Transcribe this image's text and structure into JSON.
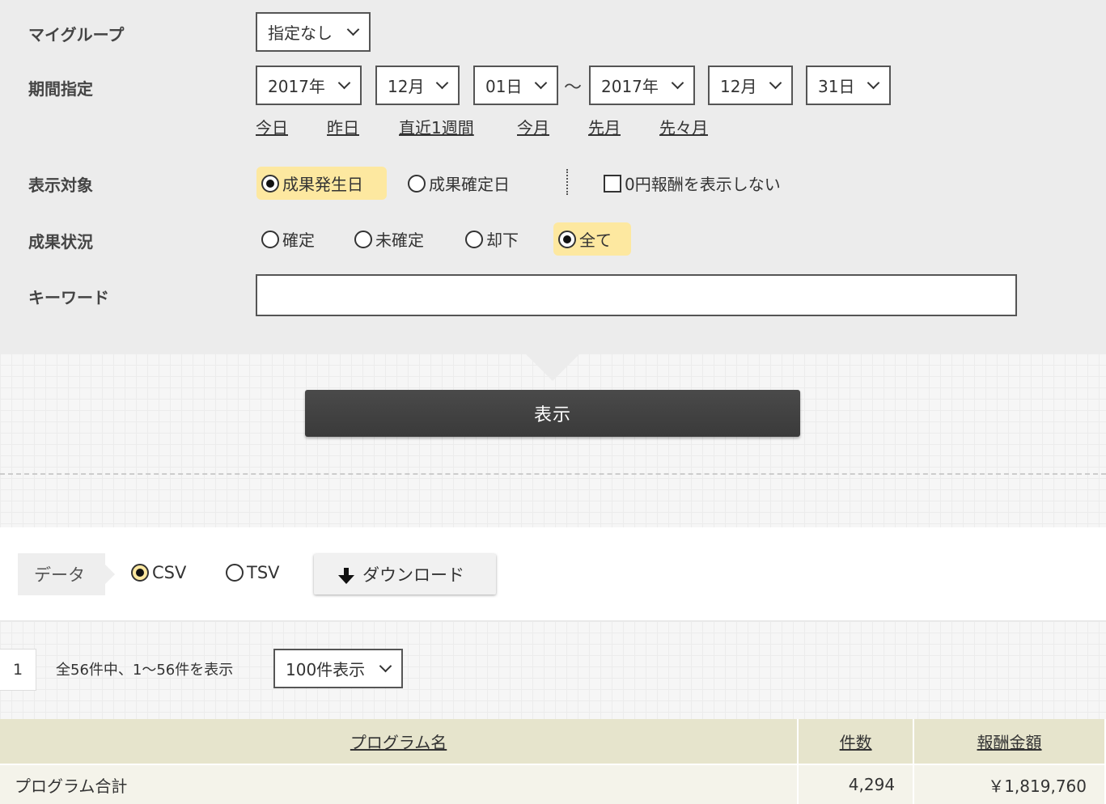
{
  "form": {
    "my_group": {
      "label": "マイグループ",
      "value": "指定なし"
    },
    "period": {
      "label": "期間指定",
      "start_year": "2017年",
      "start_month": "12月",
      "start_day": "01日",
      "separator": "～",
      "end_year": "2017年",
      "end_month": "12月",
      "end_day": "31日",
      "quick_links": [
        "今日",
        "昨日",
        "直近1週間",
        "今月",
        "先月",
        "先々月"
      ]
    },
    "display_target": {
      "label": "表示対象",
      "options": [
        "成果発生日",
        "成果確定日"
      ],
      "selected": "成果発生日",
      "checkbox_label": "0円報酬を表示しない"
    },
    "status": {
      "label": "成果状況",
      "options": [
        "確定",
        "未確定",
        "却下",
        "全て"
      ],
      "selected": "全て"
    },
    "keyword": {
      "label": "キーワード",
      "value": ""
    },
    "show_button": "表示"
  },
  "download": {
    "data_label": "データ",
    "formats": [
      "CSV",
      "TSV"
    ],
    "selected": "CSV",
    "button_label": "ダウンロード"
  },
  "pagination": {
    "current_page": "1",
    "count_text": "全56件中、1～56件を表示",
    "per_page": "100件表示"
  },
  "table": {
    "headers": [
      "プログラム名",
      "件数",
      "報酬金額"
    ],
    "rows": [
      {
        "name": "プログラム合計",
        "count": "4,294",
        "amount": "￥1,819,760"
      }
    ]
  },
  "colors": {
    "highlight": "#fde8a0",
    "header_bg": "#e6e4cc",
    "button_dark": "#404040"
  }
}
